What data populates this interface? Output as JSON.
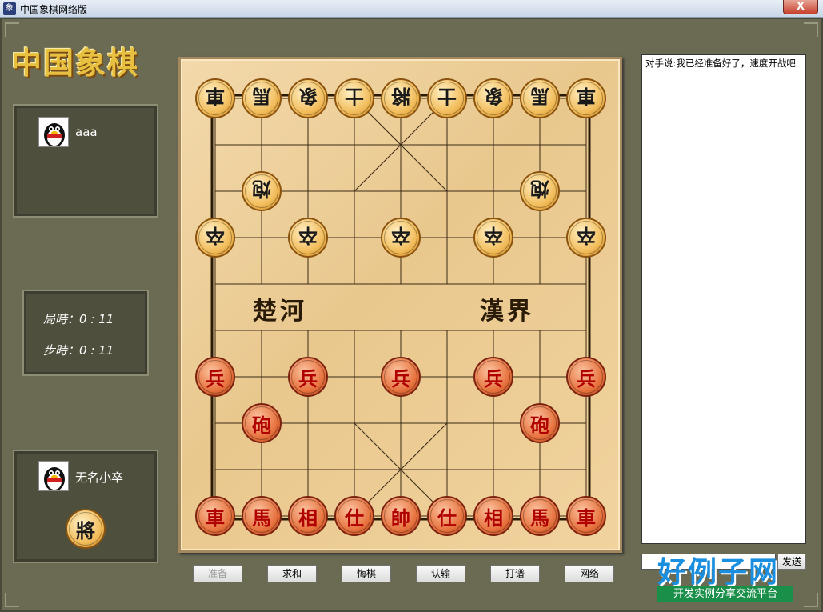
{
  "window": {
    "title": "中国象棋网络版",
    "close_label": "X",
    "app_icon_glyph": "象"
  },
  "logo": {
    "text": "中国象棋"
  },
  "opponent": {
    "name": "aaa",
    "avatar_icon": "penguin-avatar"
  },
  "timer": {
    "game_label": "局時：",
    "game_value": "0 : 11",
    "step_label": "步時：",
    "step_value": "0 : 11"
  },
  "player": {
    "name": "无名小卒",
    "general_piece": "將"
  },
  "board": {
    "river_left": "楚河",
    "river_right": "漢界",
    "black_pieces": [
      {
        "label": "車",
        "col": 0,
        "row": 0
      },
      {
        "label": "馬",
        "col": 1,
        "row": 0
      },
      {
        "label": "象",
        "col": 2,
        "row": 0
      },
      {
        "label": "士",
        "col": 3,
        "row": 0
      },
      {
        "label": "將",
        "col": 4,
        "row": 0
      },
      {
        "label": "士",
        "col": 5,
        "row": 0
      },
      {
        "label": "象",
        "col": 6,
        "row": 0
      },
      {
        "label": "馬",
        "col": 7,
        "row": 0
      },
      {
        "label": "車",
        "col": 8,
        "row": 0
      },
      {
        "label": "炮",
        "col": 1,
        "row": 2
      },
      {
        "label": "炮",
        "col": 7,
        "row": 2
      },
      {
        "label": "卒",
        "col": 0,
        "row": 3
      },
      {
        "label": "卒",
        "col": 2,
        "row": 3
      },
      {
        "label": "卒",
        "col": 4,
        "row": 3
      },
      {
        "label": "卒",
        "col": 6,
        "row": 3
      },
      {
        "label": "卒",
        "col": 8,
        "row": 3
      }
    ],
    "red_pieces": [
      {
        "label": "兵",
        "col": 0,
        "row": 6
      },
      {
        "label": "兵",
        "col": 2,
        "row": 6
      },
      {
        "label": "兵",
        "col": 4,
        "row": 6
      },
      {
        "label": "兵",
        "col": 6,
        "row": 6
      },
      {
        "label": "兵",
        "col": 8,
        "row": 6
      },
      {
        "label": "砲",
        "col": 1,
        "row": 7
      },
      {
        "label": "砲",
        "col": 7,
        "row": 7
      },
      {
        "label": "車",
        "col": 0,
        "row": 9
      },
      {
        "label": "馬",
        "col": 1,
        "row": 9
      },
      {
        "label": "相",
        "col": 2,
        "row": 9
      },
      {
        "label": "仕",
        "col": 3,
        "row": 9
      },
      {
        "label": "帥",
        "col": 4,
        "row": 9
      },
      {
        "label": "仕",
        "col": 5,
        "row": 9
      },
      {
        "label": "相",
        "col": 6,
        "row": 9
      },
      {
        "label": "馬",
        "col": 7,
        "row": 9
      },
      {
        "label": "車",
        "col": 8,
        "row": 9
      }
    ]
  },
  "buttons": {
    "ready": "准备",
    "draw": "求和",
    "undo": "悔棋",
    "resign": "认输",
    "record": "打谱",
    "network": "网络"
  },
  "chat": {
    "message": "对手说:我已经准备好了，速度开战吧",
    "input_value": "",
    "send_label": "发送"
  },
  "watermark": {
    "logo": "好例子网",
    "slogan": "开发实例分享交流平台"
  },
  "colors": {
    "red_piece": "#b10000",
    "black_piece": "#1a1a1a",
    "board": "#f0d29c",
    "frame": "#6b6a52"
  }
}
